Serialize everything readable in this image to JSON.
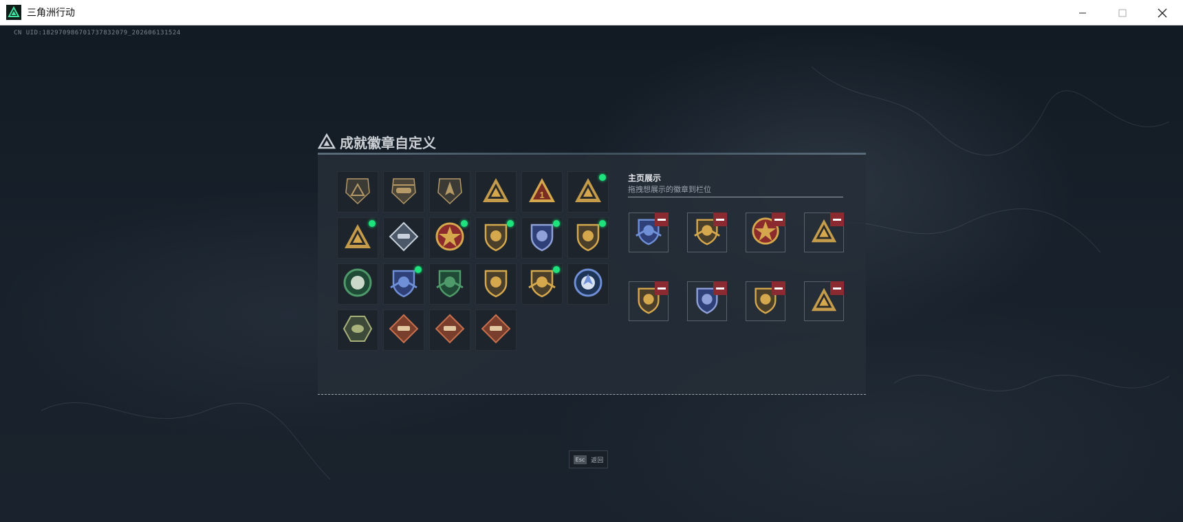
{
  "window": {
    "title": "三角洲行动",
    "minimize_icon": "minimize-icon",
    "maximize_icon": "maximize-icon",
    "close_icon": "close-icon"
  },
  "overlay": {
    "uid": "CN UID:1829709867017378320​79_202606131524"
  },
  "dialog": {
    "title": "成就徽章自定义",
    "badges": [
      {
        "icon": "triangle-emblem-dark",
        "new": false,
        "color": "#b59a68"
      },
      {
        "icon": "helicopter-emblem",
        "new": false,
        "color": "#b59a68"
      },
      {
        "icon": "arrow-shield-emblem",
        "new": false,
        "color": "#b59a68"
      },
      {
        "icon": "helmet-triangle-emblem",
        "new": false,
        "color": "#d6a84e"
      },
      {
        "icon": "number-one-triangle-emblem",
        "new": false,
        "color": "#d6a84e"
      },
      {
        "icon": "eagle-triangle-emblem",
        "new": true,
        "color": "#d6a84e"
      },
      {
        "icon": "mountain-triangle-emblem",
        "new": true,
        "color": "#d6a84e"
      },
      {
        "icon": "rifle-diamond-emblem",
        "new": false,
        "color": "#c9d2dc"
      },
      {
        "icon": "star-medal-emblem",
        "new": true,
        "color": "#d6a84e"
      },
      {
        "icon": "gold-shield-emblem",
        "new": true,
        "color": "#d6a84e"
      },
      {
        "icon": "blue-shield-emblem",
        "new": true,
        "color": "#8fa1d8"
      },
      {
        "icon": "lion-shield-emblem",
        "new": true,
        "color": "#d6a84e"
      },
      {
        "icon": "green-round-emblem",
        "new": false,
        "color": "#4f9a6a"
      },
      {
        "icon": "blue-wing-shield-emblem",
        "new": true,
        "color": "#6f8fd6"
      },
      {
        "icon": "green-wing-shield-emblem",
        "new": false,
        "color": "#4f9a6a"
      },
      {
        "icon": "rifle-shield-emblem",
        "new": false,
        "color": "#d6a84e"
      },
      {
        "icon": "gold-wing-shield-emblem",
        "new": true,
        "color": "#d6a84e"
      },
      {
        "icon": "arrow-circle-emblem",
        "new": false,
        "color": "#6f8fd6"
      },
      {
        "icon": "hornet-hexagon-emblem",
        "new": false,
        "color": "#a9b27a"
      },
      {
        "icon": "dragon-diamond-emblem",
        "new": false,
        "color": "#c6704e"
      },
      {
        "icon": "horse-diamond-emblem",
        "new": false,
        "color": "#c6704e"
      },
      {
        "icon": "armor-diamond-emblem",
        "new": false,
        "color": "#c6704e"
      }
    ],
    "showcase": {
      "title": "主页展示",
      "subtitle": "拖拽想展示的徽章到栏位",
      "remove_icon": "remove-icon",
      "slots": [
        {
          "icon": "blue-wing-shield-emblem",
          "color": "#6f8fd6"
        },
        {
          "icon": "gold-wing-shield-emblem",
          "color": "#d6a84e"
        },
        {
          "icon": "star-medal-emblem",
          "color": "#d6a84e"
        },
        {
          "icon": "mountain-triangle-emblem",
          "color": "#d6a84e"
        },
        {
          "icon": "lion-shield-emblem",
          "color": "#d6a84e"
        },
        {
          "icon": "blue-shield-emblem",
          "color": "#8fa1d8"
        },
        {
          "icon": "gold-shield-emblem",
          "color": "#d6a84e"
        },
        {
          "icon": "eagle-triangle-emblem",
          "color": "#d6a84e"
        }
      ]
    }
  },
  "footer": {
    "esc_key": "Esc",
    "esc_label": "返回"
  }
}
